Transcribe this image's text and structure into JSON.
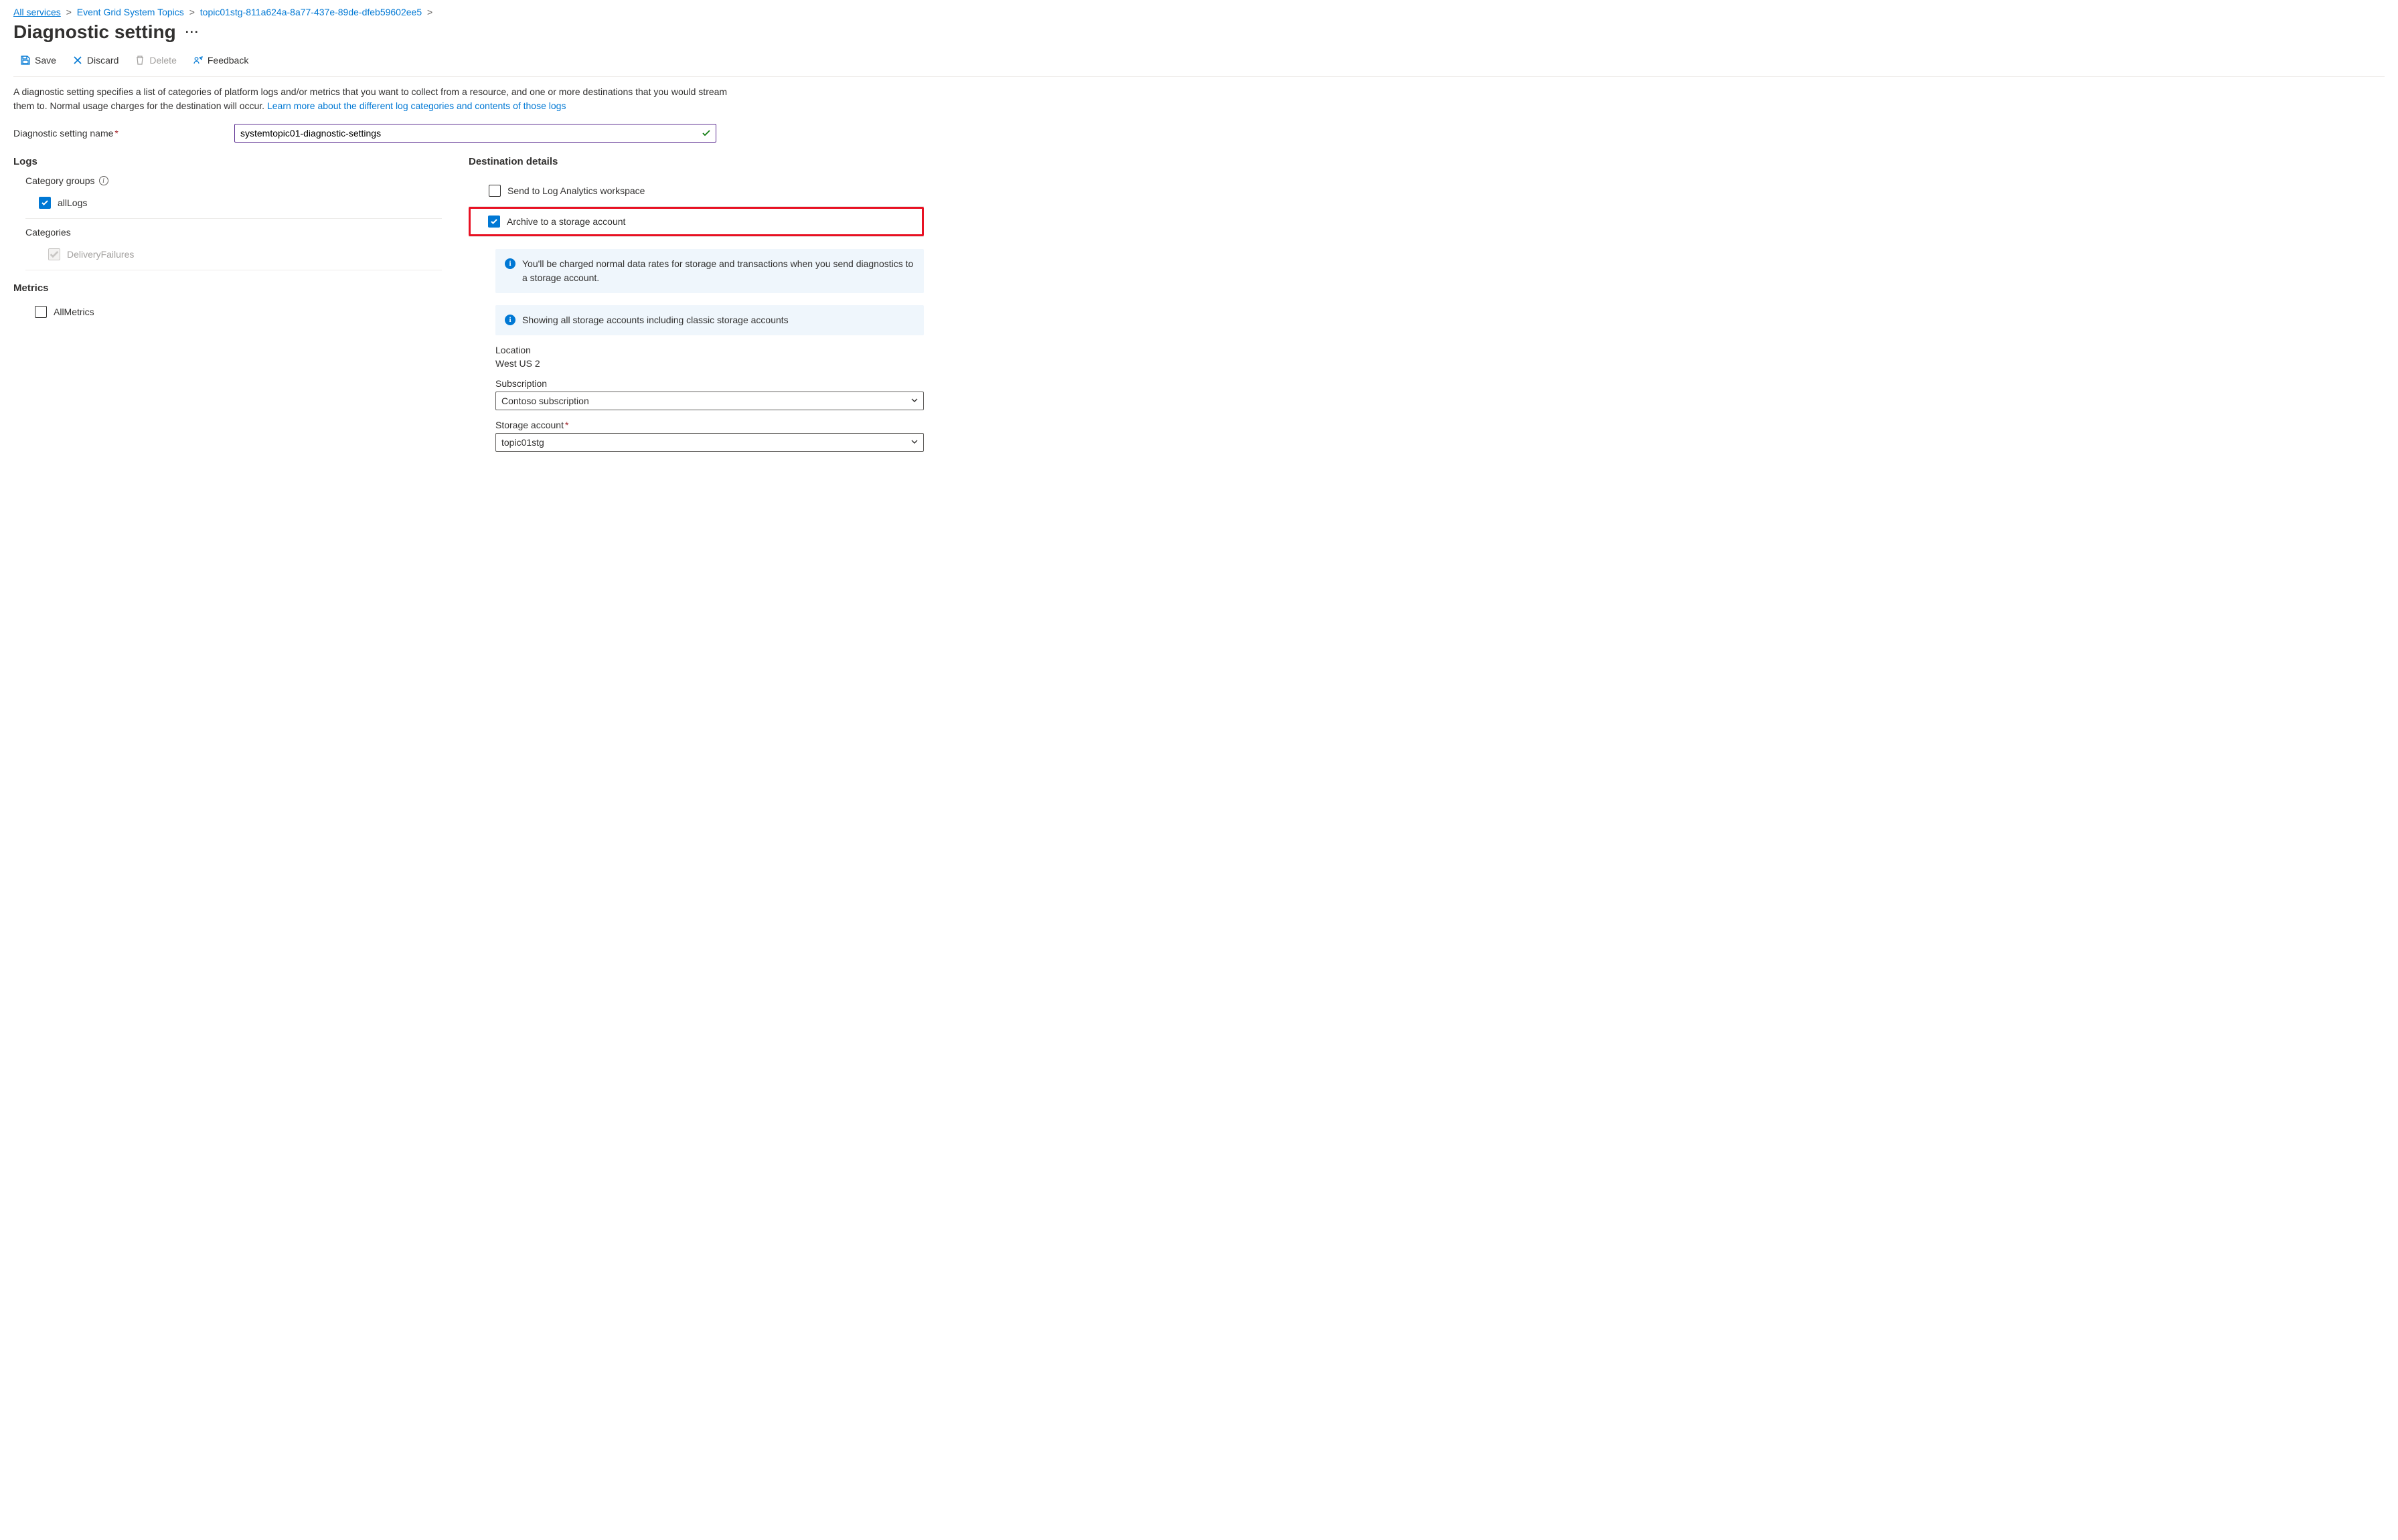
{
  "breadcrumb": {
    "items": [
      {
        "label": "All services"
      },
      {
        "label": "Event Grid System Topics"
      },
      {
        "label": "topic01stg-811a624a-8a77-437e-89de-dfeb59602ee5"
      }
    ]
  },
  "page": {
    "title": "Diagnostic setting"
  },
  "toolbar": {
    "save": "Save",
    "discard": "Discard",
    "delete": "Delete",
    "feedback": "Feedback"
  },
  "description": {
    "text": "A diagnostic setting specifies a list of categories of platform logs and/or metrics that you want to collect from a resource, and one or more destinations that you would stream them to. Normal usage charges for the destination will occur. ",
    "link": "Learn more about the different log categories and contents of those logs"
  },
  "settingName": {
    "label": "Diagnostic setting name",
    "value": "systemtopic01-diagnostic-settings"
  },
  "logs": {
    "title": "Logs",
    "categoryGroupsLabel": "Category groups",
    "allLogs": "allLogs",
    "categoriesLabel": "Categories",
    "deliveryFailures": "DeliveryFailures"
  },
  "metrics": {
    "title": "Metrics",
    "allMetrics": "AllMetrics"
  },
  "destination": {
    "title": "Destination details",
    "sendLogAnalytics": "Send to Log Analytics workspace",
    "archiveStorage": "Archive to a storage account",
    "info1": "You'll be charged normal data rates for storage and transactions when you send diagnostics to a storage account.",
    "info2": "Showing all storage accounts including classic storage accounts",
    "locationLabel": "Location",
    "locationValue": "West US 2",
    "subscriptionLabel": "Subscription",
    "subscriptionValue": "Contoso subscription",
    "storageAccountLabel": "Storage account",
    "storageAccountValue": "topic01stg"
  }
}
